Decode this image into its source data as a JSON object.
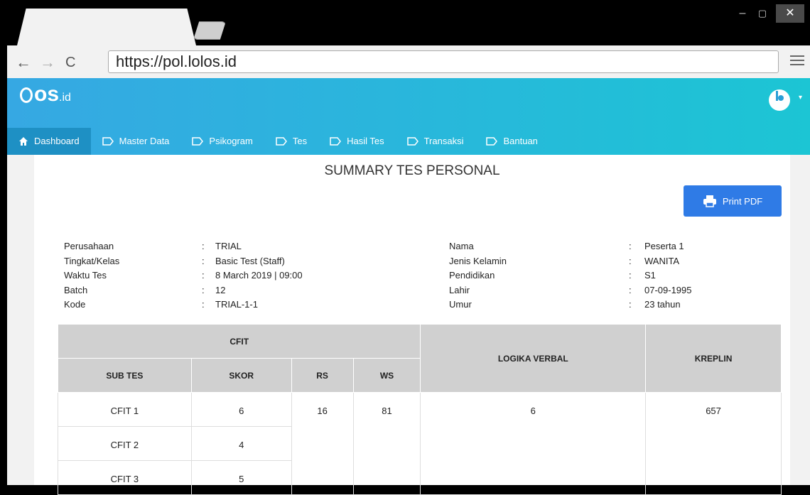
{
  "browser": {
    "url": "https://pol.lolos.id",
    "win_min": "–",
    "win_max": "▢",
    "win_close": "✕"
  },
  "app": {
    "logo_text": "os",
    "logo_suffix": ".id",
    "logo_prefix": "l"
  },
  "nav": {
    "items": [
      {
        "label": "Dashboard",
        "icon": "home-icon"
      },
      {
        "label": "Master Data",
        "icon": "tag-icon"
      },
      {
        "label": "Psikogram",
        "icon": "tag-icon"
      },
      {
        "label": "Tes",
        "icon": "tag-icon"
      },
      {
        "label": "Hasil Tes",
        "icon": "tag-icon"
      },
      {
        "label": "Transaksi",
        "icon": "tag-icon"
      },
      {
        "label": "Bantuan",
        "icon": "tag-icon"
      }
    ]
  },
  "page": {
    "title": "SUMMARY TES PERSONAL",
    "print_label": "Print PDF"
  },
  "info_left": [
    {
      "label": "Perusahaan",
      "sep": ":",
      "value": "TRIAL"
    },
    {
      "label": "Tingkat/Kelas",
      "sep": ":",
      "value": "Basic Test (Staff)"
    },
    {
      "label": "Waktu Tes",
      "sep": ":",
      "value": "8 March 2019 | 09:00"
    },
    {
      "label": "Batch",
      "sep": ":",
      "value": "12"
    },
    {
      "label": "Kode",
      "sep": ":",
      "value": "TRIAL-1-1"
    }
  ],
  "info_right": [
    {
      "label": "Nama",
      "sep": ":",
      "value": "Peserta 1"
    },
    {
      "label": "Jenis Kelamin",
      "sep": ":",
      "value": "WANITA"
    },
    {
      "label": "Pendidikan",
      "sep": ":",
      "value": "S1"
    },
    {
      "label": "Lahir",
      "sep": ":",
      "value": "07-09-1995"
    },
    {
      "label": "Umur",
      "sep": ":",
      "value": "23 tahun"
    }
  ],
  "table": {
    "group_cfit": "CFIT",
    "col_logika": "LOGIKA VERBAL",
    "col_kreplin": "KREPLIN",
    "col_subtes": "SUB TES",
    "col_skor": "SKOR",
    "col_rs": "RS",
    "col_ws": "WS",
    "rows": [
      {
        "subtes": "CFIT 1",
        "skor": "6"
      },
      {
        "subtes": "CFIT 2",
        "skor": "4"
      },
      {
        "subtes": "CFIT 3",
        "skor": "5"
      }
    ],
    "rs": "16",
    "ws": "81",
    "logika": "6",
    "kreplin": "657"
  }
}
